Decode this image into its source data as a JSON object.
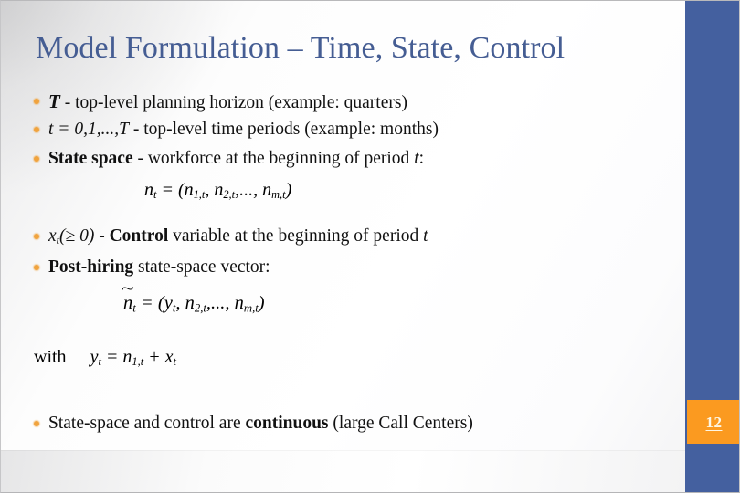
{
  "slide": {
    "title": "Model Formulation – Time, State, Control",
    "page_number": "12",
    "accent_blue": "#44609f",
    "accent_orange": "#fb9a20",
    "title_color": "#455d93",
    "bullet_color": "#f0a33e"
  },
  "bullets": {
    "b1": {
      "symbol": "T",
      "text": " - top-level planning horizon  (example: quarters)"
    },
    "b2": {
      "symbol_t": "t",
      "symbol_eq": " = 0,1,...,",
      "symbol_T": "T",
      "text": "  - top-level time periods (example: months)"
    },
    "b3": {
      "bold_lead": "State space",
      "text": " - workforce at the beginning of period ",
      "var_t": "t",
      "tail": ":"
    },
    "b4": {
      "var_x": "x",
      "sub_t": "t",
      "paren": "(≥ 0)",
      "dash": " - ",
      "bold_lead": "Control",
      "text": " variable at the beginning of  period ",
      "var_t": "t"
    },
    "b5": {
      "bold_lead": "Post-hiring",
      "text": " state-space vector:"
    },
    "b6": {
      "text_lead": "State-space and control are ",
      "bold_word": "continuous",
      "text_tail": " (large Call Centers)"
    }
  },
  "equations": {
    "state_vector": {
      "lhs_var": "n",
      "lhs_sub": "t",
      "eq": " = (",
      "e1_var": "n",
      "e1_sub": "1,t",
      "sep1": ", ",
      "e2_var": "n",
      "e2_sub": "2,t",
      "sep2": ",..., ",
      "e3_var": "n",
      "e3_sub": "m,t",
      "close": ")"
    },
    "post_hiring_vector": {
      "lhs_var": "n",
      "lhs_tilde": "~",
      "lhs_sub": "t",
      "eq": " = (",
      "e1_var": "y",
      "e1_sub": "t",
      "sep1": ", ",
      "e2_var": "n",
      "e2_sub": "2,t",
      "sep2": ",..., ",
      "e3_var": "n",
      "e3_sub": "m,t",
      "close": ")"
    },
    "with_relation": {
      "label": "with",
      "lhs_var": "y",
      "lhs_sub": "t",
      "eq": " = ",
      "rhs1_var": "n",
      "rhs1_sub": "1,t",
      "plus": " + ",
      "rhs2_var": "x",
      "rhs2_sub": "t"
    }
  }
}
